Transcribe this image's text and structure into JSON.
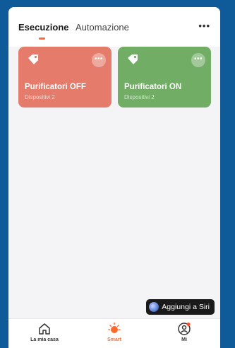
{
  "header": {
    "tabs": [
      {
        "label": "Esecuzione",
        "active": true
      },
      {
        "label": "Automazione",
        "active": false
      }
    ],
    "more_label": "•••"
  },
  "scenes": [
    {
      "name": "Purificatori OFF",
      "subtitle": "Dispositivi 2",
      "color": "#e47b6b",
      "icon": "tag-icon"
    },
    {
      "name": "Purificatori ON",
      "subtitle": "Dispositivi 2",
      "color": "#72ad66",
      "icon": "tag-icon"
    }
  ],
  "scene_menu_label": "•••",
  "siri_button": {
    "label": "Aggiungi a Siri",
    "icon": "siri-icon"
  },
  "tabbar": {
    "items": [
      {
        "label": "La mia casa",
        "icon": "home-icon",
        "active": false
      },
      {
        "label": "Smart",
        "icon": "sun-icon",
        "active": true
      },
      {
        "label": "Mi",
        "icon": "profile-icon",
        "active": false
      }
    ]
  },
  "colors": {
    "accent": "#ff6a2c",
    "background": "#0f5a99"
  }
}
